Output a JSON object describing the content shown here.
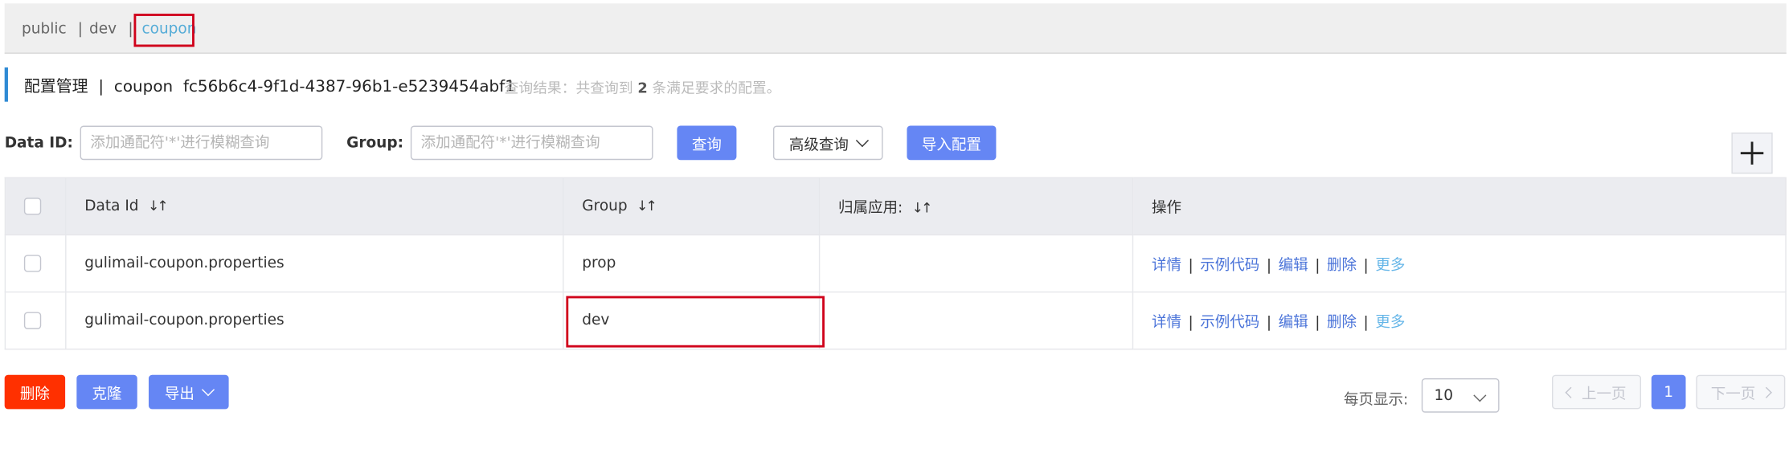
{
  "namespaces": {
    "items": [
      "public",
      "dev",
      "coupon"
    ],
    "separator": "|",
    "active": "coupon"
  },
  "title": {
    "section": "配置管理",
    "separator": "|",
    "namespace_name": "coupon",
    "namespace_id": "fc56b6c4-9f1d-4387-96b1-e5239454abf1",
    "result_prefix": "查询结果：共查询到",
    "result_count": "2",
    "result_suffix": "条满足要求的配置。"
  },
  "search": {
    "data_id_label": "Data ID:",
    "data_id_placeholder": "添加通配符'*'进行模糊查询",
    "group_label": "Group:",
    "group_placeholder": "添加通配符'*'进行模糊查询",
    "query_button": "查询",
    "advanced_button": "高级查询",
    "import_button": "导入配置"
  },
  "table": {
    "columns": [
      "Data Id",
      "Group",
      "归属应用:",
      "操作"
    ],
    "rows": [
      {
        "data_id": "gulimail-coupon.properties",
        "group": "prop",
        "app": ""
      },
      {
        "data_id": "gulimail-coupon.properties",
        "group": "dev",
        "app": ""
      }
    ],
    "actions": {
      "detail": "详情",
      "sample": "示例代码",
      "edit": "编辑",
      "delete": "删除",
      "more": "更多",
      "separator": "|"
    }
  },
  "footer": {
    "delete_button": "删除",
    "clone_button": "克隆",
    "export_button": "导出",
    "page_size_label": "每页显示:",
    "page_size_value": "10",
    "prev_button": "上一页",
    "current_page": "1",
    "next_button": "下一页"
  },
  "colors": {
    "primary": "#6586f4",
    "danger": "#ff3000",
    "active_tab": "#55acd7",
    "highlight_box": "#d0021b",
    "title_accent": "#2f8ad4"
  }
}
